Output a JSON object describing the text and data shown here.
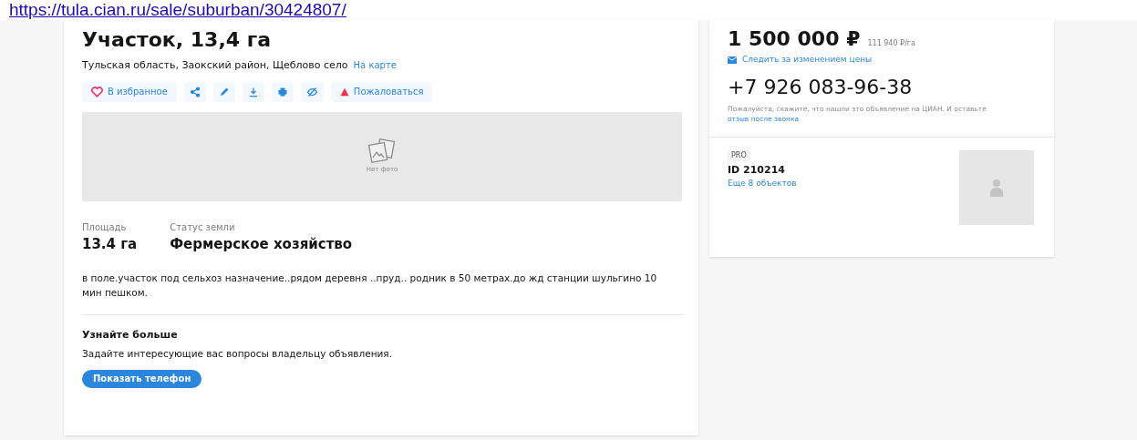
{
  "url": "https://tula.cian.ru/sale/suburban/30424807/",
  "title": "Участок, 13,4 га",
  "address": "Тульская область, Заокский район, Щеблово село",
  "map_link": "На карте",
  "actions": [
    {
      "kind": "favorite",
      "label": "В избранное"
    },
    {
      "kind": "share"
    },
    {
      "kind": "edit"
    },
    {
      "kind": "download"
    },
    {
      "kind": "print"
    },
    {
      "kind": "hide"
    },
    {
      "kind": "report",
      "label": "Пожаловаться"
    }
  ],
  "photo": {
    "placeholder": "Нет фото"
  },
  "facts": [
    {
      "label": "Площадь",
      "value": "13.4 га"
    },
    {
      "label": "Статус земли",
      "value": "Фермерское хозяйство"
    }
  ],
  "description": "в поле.участок под сельхоз назначение..рядом деревня ..пруд.. родник в 50 метрах.до жд станции шульгино 10 мин пешком.",
  "contact": {
    "heading": "Узнайте больше",
    "text": "Задайте интересующие вас вопросы владельцу объявления.",
    "button": "Показать телефон"
  },
  "price": {
    "value": "1 500 000 ₽",
    "per_unit": "111 940 ₽/га",
    "watch": "Следить за изменением цены"
  },
  "phone": {
    "number": "+7 926 083-96-38",
    "note": "Пожалуйста, скажите, что нашли это объявление на ЦИАН. И оставьте ",
    "note_link": "отзыв после звонка"
  },
  "agent": {
    "badge": "PRO",
    "id": "ID 210214",
    "more": "Еще 8 объектов"
  }
}
